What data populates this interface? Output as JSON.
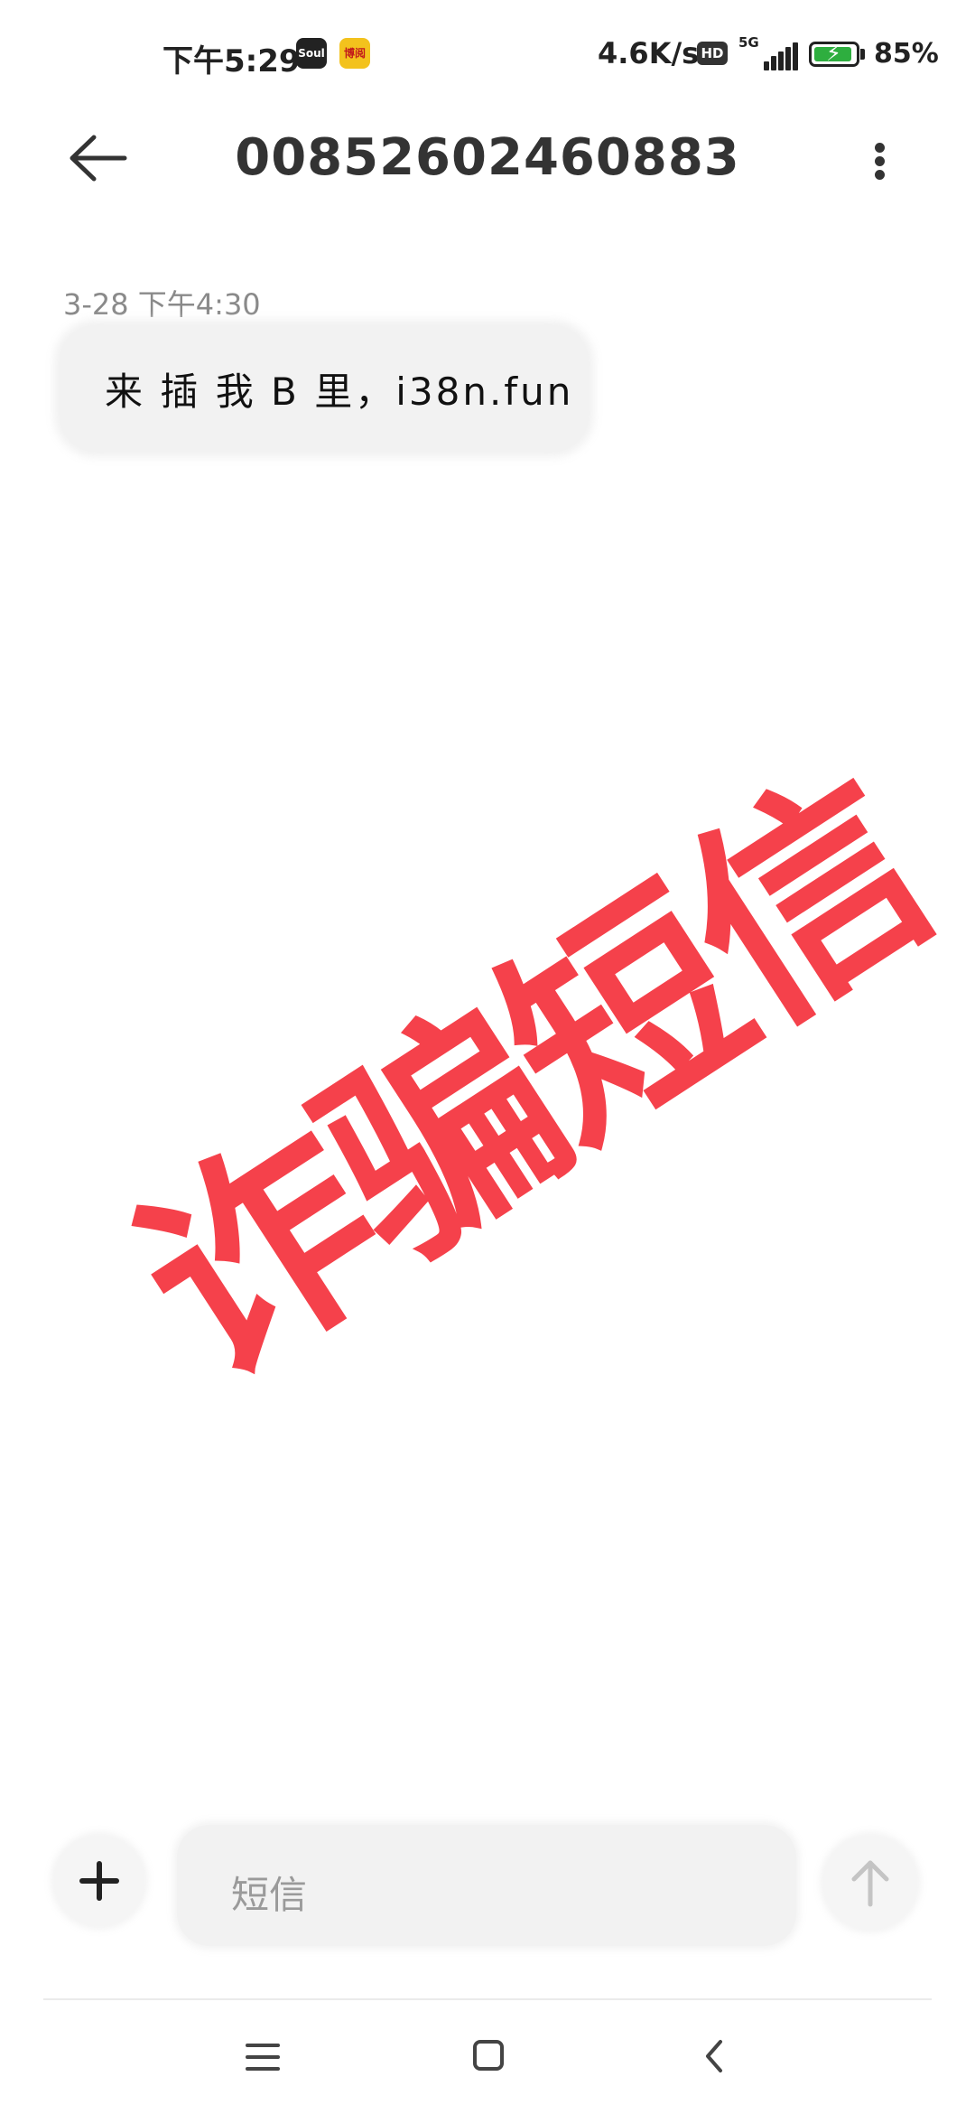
{
  "status_bar": {
    "time": "下午5:29",
    "apps": [
      "Soul",
      "博阅"
    ],
    "net_speed": "4.6K/s",
    "hd": "HD",
    "network": "5G",
    "battery_percent": "85%",
    "battery_level": 0.85
  },
  "header": {
    "title": "00852602460883",
    "back_icon": "arrow-left-icon",
    "more_icon": "vertical-ellipsis-icon"
  },
  "messages": [
    {
      "timestamp": "3-28 下午4:30",
      "text": "来 插 我 B 里，i38n.fun"
    }
  ],
  "watermark": {
    "text": "诈骗短信",
    "color": "#f5414b"
  },
  "composer": {
    "placeholder": "短信",
    "add_icon": "plus-icon",
    "send_icon": "arrow-up-icon"
  },
  "nav_bar": {
    "icons": [
      "menu-icon",
      "home-icon",
      "back-icon"
    ]
  }
}
